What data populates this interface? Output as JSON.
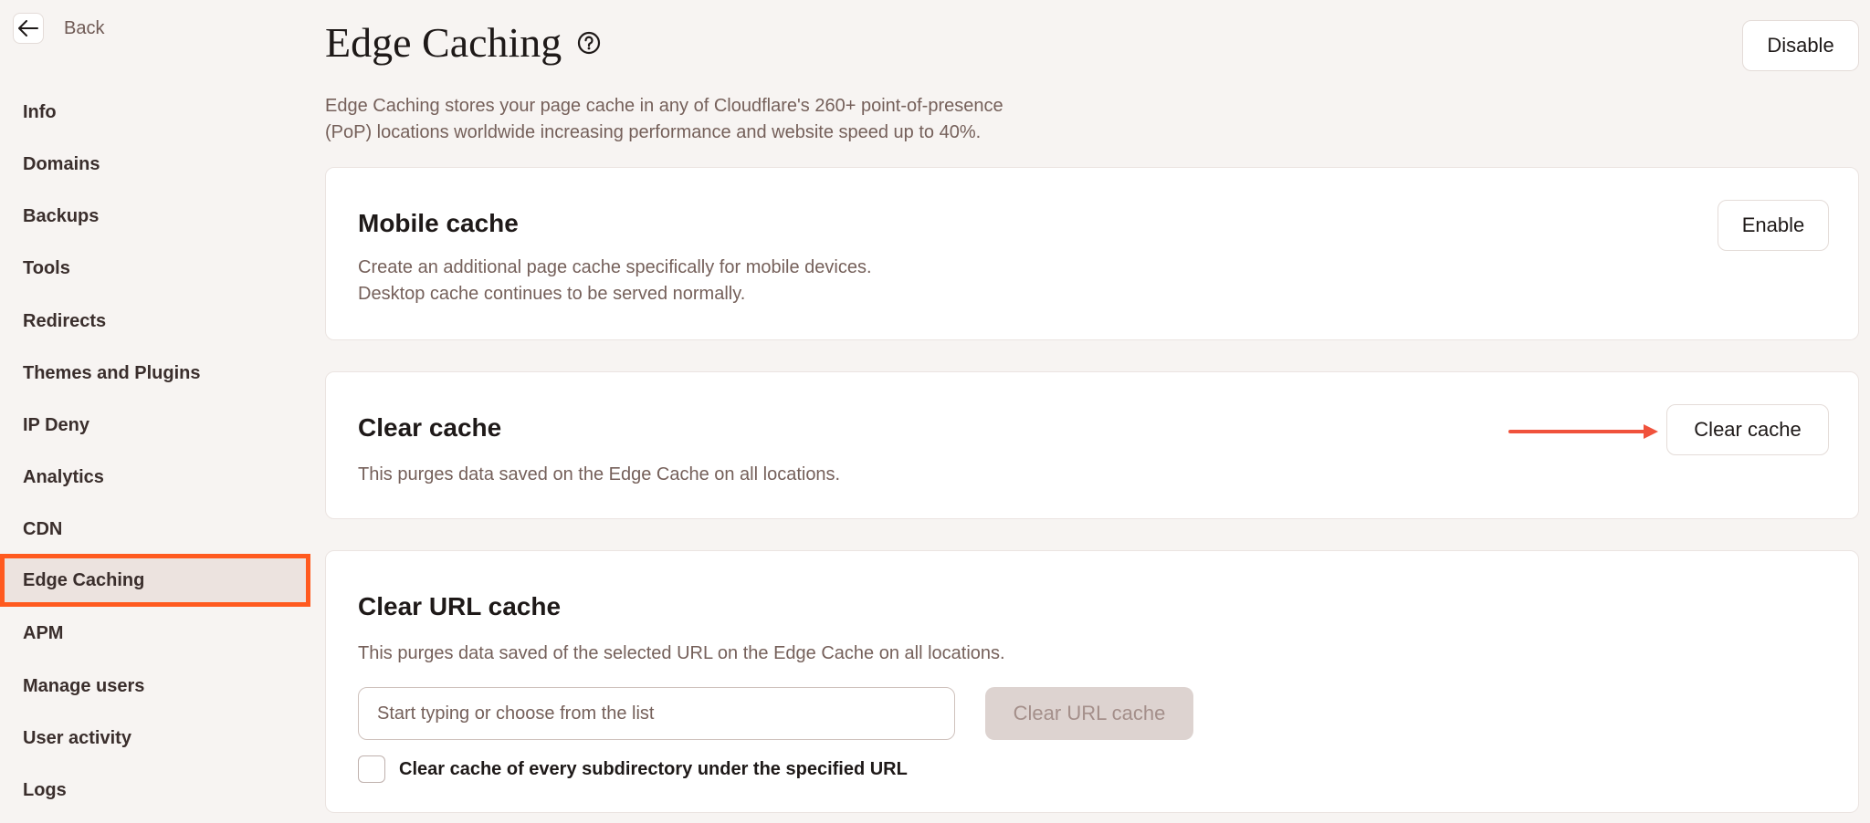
{
  "nav": {
    "back_label": "Back",
    "items": [
      {
        "label": "Info",
        "active": false
      },
      {
        "label": "Domains",
        "active": false
      },
      {
        "label": "Backups",
        "active": false
      },
      {
        "label": "Tools",
        "active": false
      },
      {
        "label": "Redirects",
        "active": false
      },
      {
        "label": "Themes and Plugins",
        "active": false
      },
      {
        "label": "IP Deny",
        "active": false
      },
      {
        "label": "Analytics",
        "active": false
      },
      {
        "label": "CDN",
        "active": false
      },
      {
        "label": "Edge Caching",
        "active": true
      },
      {
        "label": "APM",
        "active": false
      },
      {
        "label": "Manage users",
        "active": false
      },
      {
        "label": "User activity",
        "active": false
      },
      {
        "label": "Logs",
        "active": false
      }
    ]
  },
  "header": {
    "title": "Edge Caching",
    "help_icon": "question-circle-icon",
    "disable_label": "Disable",
    "description_line1": "Edge Caching stores your page cache in any of Cloudflare's 260+ point-of-presence",
    "description_line2": "(PoP) locations worldwide increasing performance and website speed up to 40%."
  },
  "mobile_cache": {
    "title": "Mobile cache",
    "desc_line1": "Create an additional page cache specifically for mobile devices.",
    "desc_line2": "Desktop cache continues to be served normally.",
    "button_label": "Enable"
  },
  "clear_cache": {
    "title": "Clear cache",
    "desc": "This purges data saved on the Edge Cache on all locations.",
    "button_label": "Clear cache"
  },
  "clear_url_cache": {
    "title": "Clear URL cache",
    "desc": "This purges data saved of the selected URL on the Edge Cache on all locations.",
    "input_placeholder": "Start typing or choose from the list",
    "input_value": "",
    "button_label": "Clear URL cache",
    "checkbox_label": "Clear cache of every subdirectory under the specified URL",
    "checkbox_checked": false
  },
  "colors": {
    "highlight": "#ff5a1f",
    "arrow": "#f0523c",
    "background": "#f7f4f2"
  }
}
